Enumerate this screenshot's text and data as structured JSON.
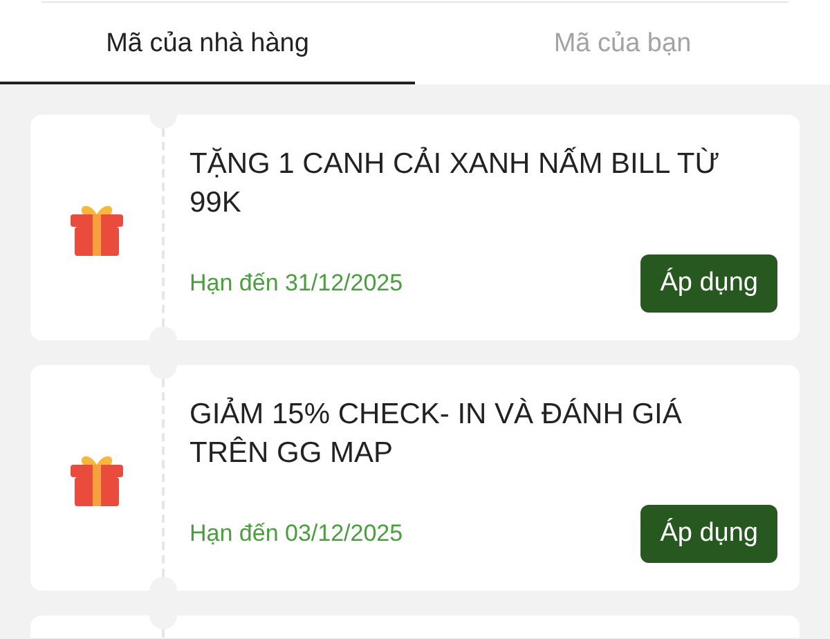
{
  "tabs": [
    {
      "label": "Mã của nhà hàng",
      "selected": true
    },
    {
      "label": "Mã của bạn",
      "selected": false
    }
  ],
  "vouchers": [
    {
      "title": "TẶNG 1 CANH CẢI XANH NẤM BILL TỪ 99K",
      "expiry": "Hạn đến 31/12/2025",
      "button": "Áp dụng"
    },
    {
      "title": "GIẢM 15% CHECK- IN VÀ ĐÁNH GIÁ TRÊN GG MAP",
      "expiry": "Hạn đến 03/12/2025",
      "button": "Áp dụng"
    }
  ]
}
